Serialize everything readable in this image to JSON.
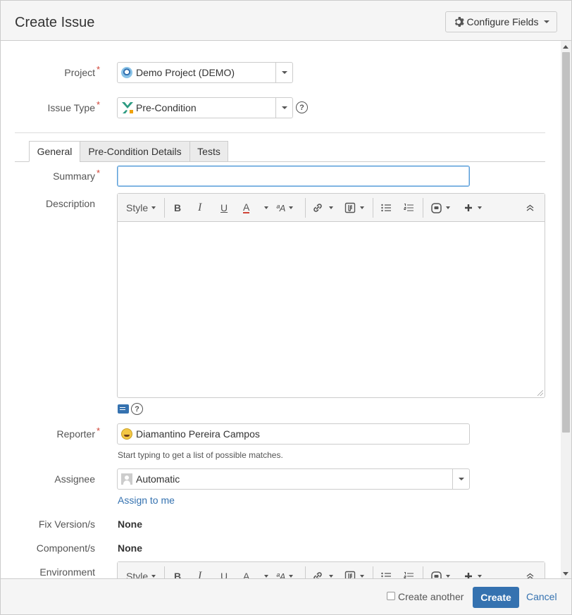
{
  "dialog": {
    "title": "Create Issue",
    "configure_fields": "Configure Fields"
  },
  "project": {
    "label": "Project",
    "value": "Demo Project (DEMO)"
  },
  "issue_type": {
    "label": "Issue Type",
    "value": "Pre-Condition"
  },
  "required_marker": "*",
  "tabs": [
    {
      "label": "General",
      "active": true
    },
    {
      "label": "Pre-Condition Details",
      "active": false
    },
    {
      "label": "Tests",
      "active": false
    }
  ],
  "summary": {
    "label": "Summary",
    "value": "",
    "placeholder": ""
  },
  "description": {
    "label": "Description"
  },
  "toolbar": {
    "style_label": "Style",
    "bold": "B",
    "italic": "I",
    "underline": "U",
    "text_color": "A",
    "text_size": "ªA"
  },
  "reporter": {
    "label": "Reporter",
    "value": "Diamantino Pereira Campos",
    "hint": "Start typing to get a list of possible matches."
  },
  "assignee": {
    "label": "Assignee",
    "value": "Automatic",
    "assign_to_me": "Assign to me"
  },
  "fix_versions": {
    "label": "Fix Version/s",
    "value": "None"
  },
  "components": {
    "label": "Component/s",
    "value": "None"
  },
  "environment": {
    "label": "Environment"
  },
  "help_glyph": "?",
  "footer": {
    "create_another": "Create another",
    "create": "Create",
    "cancel": "Cancel"
  },
  "colors": {
    "primary": "#3572b0",
    "required": "#d04437",
    "text_color_underline": "#d04437"
  }
}
